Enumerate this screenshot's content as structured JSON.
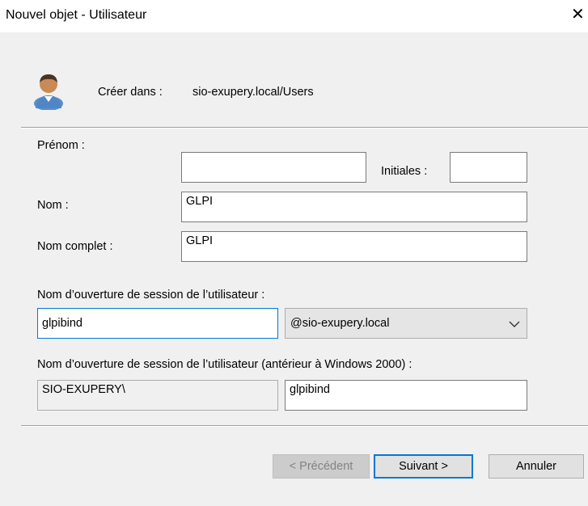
{
  "window": {
    "title": "Nouvel objet - Utilisateur",
    "close_glyph": "✕"
  },
  "header": {
    "create_in_label": "Créer dans :",
    "create_in_value": "sio-exupery.local/Users",
    "icon": "user-icon"
  },
  "form": {
    "first_name_label": "Prénom :",
    "first_name_value": "",
    "initials_label": "Initiales :",
    "initials_value": "",
    "last_name_label": "Nom :",
    "last_name_value": "GLPI",
    "full_name_label": "Nom complet :",
    "full_name_value": "GLPI",
    "logon_name_label": "Nom d’ouverture de session de l’utilisateur :",
    "logon_name_value": "glpibind",
    "domain_selected": "@sio-exupery.local",
    "pre2000_label": "Nom d’ouverture de session de l’utilisateur (antérieur à Windows 2000) :",
    "pre2000_domain_value": "SIO-EXUPERY\\",
    "pre2000_name_value": "glpibind"
  },
  "buttons": {
    "previous": "< Précédent",
    "next": "Suivant >",
    "cancel": "Annuler"
  },
  "colors": {
    "focus": "#0078d7",
    "dialog_bg": "#f0f0f0"
  }
}
